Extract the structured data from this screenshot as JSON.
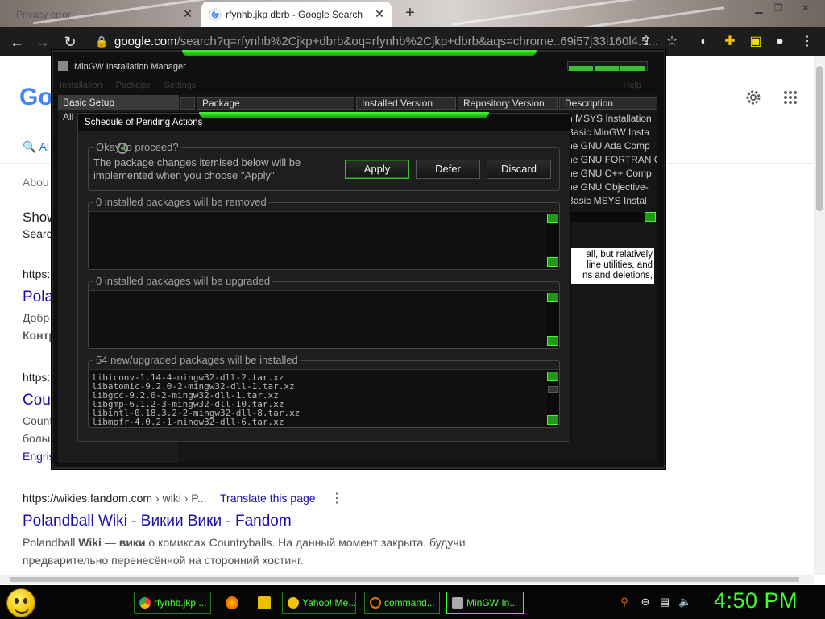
{
  "browser": {
    "tabs": [
      {
        "title": "Privacy error",
        "active": false
      },
      {
        "title": "rfynhb.jkp dbrb - Google Search",
        "active": true
      }
    ],
    "new_tab": "+",
    "address": {
      "host": "google.com",
      "rest": "/search?q=rfynhb%2Cjkp+dbrb&oq=rfynhb%2Cjkp+dbrb&aqs=chrome..69i57j33i160l4.5..."
    },
    "window_controls": [
      "▁",
      "❐",
      "✕"
    ]
  },
  "google": {
    "logo": "Go",
    "tab_all": "Al",
    "about": "Abou",
    "show": "Show",
    "search": "Searc",
    "r1_cite": "https:",
    "r1_title": "Polan",
    "r1_snip1": "Добр",
    "r1_snip2": "Контр",
    "r2_cite": "https:",
    "r2_title": "Cou",
    "r2_snip1": "Count",
    "r2_snip2": "больш",
    "r2_snip3": "Engris",
    "r3_cite_host": "https://wikies.fandom.com",
    "r3_cite_path": " › wiki › P...",
    "r3_translate": "Translate this page",
    "r3_title": "Polandball Wiki - Викии Вики - Fandom",
    "r3_snip_a": "Polandball ",
    "r3_snip_b": "Wiki",
    "r3_snip_c": " — ",
    "r3_snip_d": "вики",
    "r3_snip_e": " о комиксах Countryballs. На данный момент закрыта, будучи",
    "r3_snip_line2": "предварительно перенесённой на сторонний хостинг."
  },
  "mingw": {
    "title": "MinGW Installation Manager",
    "menu": [
      "Installation",
      "Package",
      "Settings"
    ],
    "help": "Help",
    "left_selected": "Basic Setup",
    "left_all": "All",
    "columns": [
      "Package",
      "Installed Version",
      "Repository Version",
      "Description"
    ],
    "descriptions": [
      "n MSYS Installation",
      "Basic MinGW Insta",
      "he GNU Ada Comp",
      "he GNU FORTRAN C",
      "he GNU C++ Comp",
      "he GNU Objective-",
      "Basic MSYS Instal"
    ],
    "desc_box": [
      "all, but relatively",
      "line utilities, and",
      "ns and deletions,"
    ]
  },
  "dialog": {
    "title": "Schedule of Pending Actions",
    "ok_title": "Okay to proceed?",
    "ok_message": "The package changes itemised below will be implemented when you choose \"Apply\"",
    "apply": "Apply",
    "defer": "Defer",
    "discard": "Discard",
    "remove_title": "0 installed packages will be removed",
    "upgrade_title": "0 installed packages will be upgraded",
    "install_title": "54 new/upgraded packages will be installed",
    "install_list": [
      "libiconv-1.14-4-mingw32-dll-2.tar.xz",
      "libatomic-9.2.0-2-mingw32-dll-1.tar.xz",
      "libgcc-9.2.0-2-mingw32-dll-1.tar.xz",
      "libgmp-6.1.2-3-mingw32-dll-10.tar.xz",
      "libintl-0.18.3.2-2-mingw32-dll-8.tar.xz",
      "libmpfr-4.0.2-1-mingw32-dll-6.tar.xz"
    ]
  },
  "taskbar": {
    "tasks": [
      "rfynhb.jkp ...",
      "Yahoo! Me...",
      "command...",
      "MinGW In..."
    ],
    "clock": "4:50 PM"
  }
}
